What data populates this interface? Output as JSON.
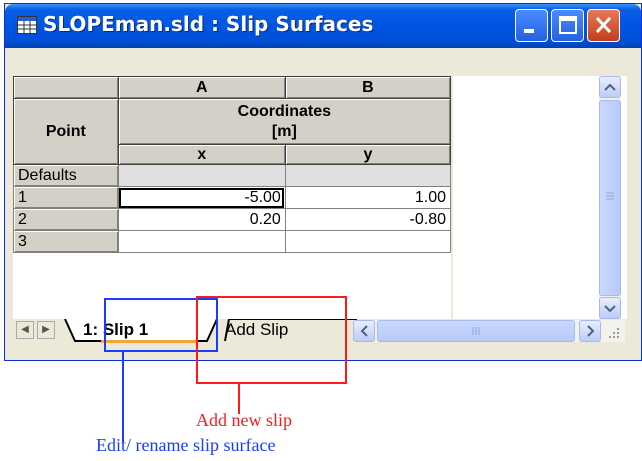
{
  "window": {
    "title": "SLOPEman.sld : Slip Surfaces",
    "accent_color": "#0054e3",
    "icons": [
      "table-icon",
      "minimize-icon",
      "maximize-icon",
      "close-icon"
    ]
  },
  "grid": {
    "column_letters": [
      "A",
      "B"
    ],
    "point_header": "Point",
    "group_header_line1": "Coordinates",
    "group_header_line2": "[m]",
    "sub_headers": [
      "x",
      "y"
    ],
    "defaults_label": "Defaults",
    "rows": [
      {
        "label": "1",
        "x": "-5.00",
        "y": "1.00"
      },
      {
        "label": "2",
        "x": "0.20",
        "y": "-0.80"
      },
      {
        "label": "3",
        "x": "",
        "y": ""
      }
    ]
  },
  "tabs": {
    "tab1_label": "1: Slip 1",
    "tab2_label": "Add Slip"
  },
  "annotations": {
    "add_new_slip": "Add new slip",
    "edit_rename": "Edit/ rename slip surface",
    "red_color": "#ff1a1a",
    "blue_color": "#1a3cff"
  }
}
